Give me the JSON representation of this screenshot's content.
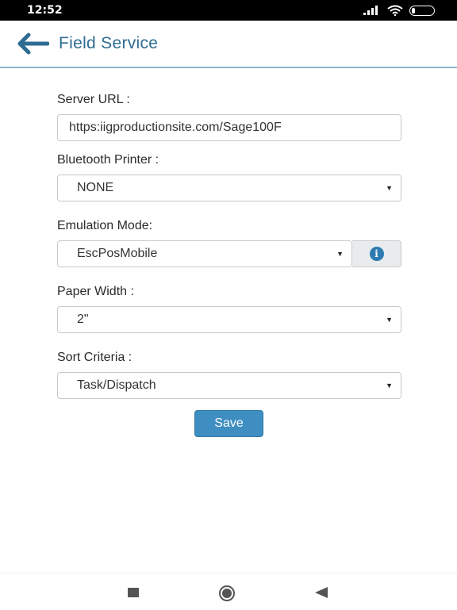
{
  "status_bar": {
    "time": "12:52",
    "signal_icon": "signal-icon",
    "wifi_icon": "wifi-icon",
    "battery_label": "14",
    "battery_level": 0.14
  },
  "header": {
    "back_icon": "arrow-left-icon",
    "title": "Field Service"
  },
  "form": {
    "server_url": {
      "label": "Server URL :",
      "value": "https:iigproductionsite.com/Sage100F"
    },
    "bluetooth_printer": {
      "label": "Bluetooth Printer :",
      "selected": "NONE"
    },
    "emulation_mode": {
      "label": "Emulation Mode:",
      "selected": "EscPosMobile",
      "info_icon": "info-icon"
    },
    "paper_width": {
      "label": "Paper Width :",
      "selected": "2\""
    },
    "sort_criteria": {
      "label": "Sort Criteria :",
      "selected": "Task/Dispatch"
    },
    "save_label": "Save"
  },
  "colors": {
    "accent": "#2e6b92",
    "button": "#3f8ec2",
    "header_rule": "#90b4c6"
  },
  "nav_bar": {
    "recents_icon": "square-icon",
    "home_icon": "home-circle-icon",
    "back_icon": "triangle-back-icon"
  }
}
